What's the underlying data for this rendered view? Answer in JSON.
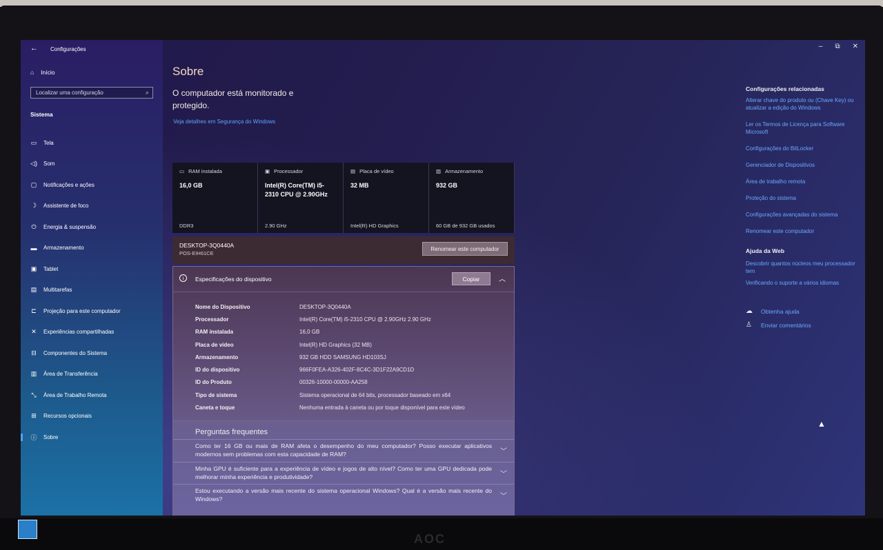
{
  "window": {
    "title": "Configurações",
    "controls": {
      "minimize": "–",
      "maximize": "⧉",
      "close": "✕"
    }
  },
  "sidebar": {
    "home": "Início",
    "search_placeholder": "Localizar uma configuração",
    "section": "Sistema",
    "items": [
      {
        "label": "Tela",
        "icon": "display-icon"
      },
      {
        "label": "Som",
        "icon": "speaker-icon"
      },
      {
        "label": "Notificações e ações",
        "icon": "notification-icon"
      },
      {
        "label": "Assistente de foco",
        "icon": "moon-icon"
      },
      {
        "label": "Energia & suspensão",
        "icon": "power-icon"
      },
      {
        "label": "Armazenamento",
        "icon": "storage-icon"
      },
      {
        "label": "Tablet",
        "icon": "tablet-icon"
      },
      {
        "label": "Multitarefas",
        "icon": "multitask-icon"
      },
      {
        "label": "Projeção para este computador",
        "icon": "projection-icon"
      },
      {
        "label": "Experiências compartilhadas",
        "icon": "shared-icon"
      },
      {
        "label": "Componentes do Sistema",
        "icon": "components-icon"
      },
      {
        "label": "Área de Transferência",
        "icon": "clipboard-icon"
      },
      {
        "label": "Área de Trabalho Remota",
        "icon": "remote-desktop-icon"
      },
      {
        "label": "Recursos opcionais",
        "icon": "optional-features-icon"
      },
      {
        "label": "Sobre",
        "icon": "info-icon"
      }
    ]
  },
  "main": {
    "title": "Sobre",
    "monitor_message": "O computador está monitorado e protegido.",
    "security_link": "Veja detalhes em Segurança do Windows",
    "cards": [
      {
        "head": "RAM instalada",
        "value": "16,0 GB",
        "sub": "DDR3"
      },
      {
        "head": "Processador",
        "value": "Intel(R) Core(TM) i5-2310 CPU @ 2.90GHz",
        "sub": "2.90 GHz"
      },
      {
        "head": "Placa de vídeo",
        "value": "32 MB",
        "sub": "Intel(R) HD Graphics"
      },
      {
        "head": "Armazenamento",
        "value": "932 GB",
        "sub": "60 GB de 932 GB usados"
      }
    ],
    "pc": {
      "name": "DESKTOP-3Q0440A",
      "model": "POS-EIH61CE",
      "rename_button": "Renomear este computador"
    },
    "specs": {
      "title": "Especificações do dispositivo",
      "copy_button": "Copiar",
      "rows": [
        {
          "key": "Nome do Dispositivo",
          "value": "DESKTOP-3Q0440A"
        },
        {
          "key": "Processador",
          "value": "Intel(R) Core(TM) i5-2310 CPU @ 2.90GHz   2.90 GHz"
        },
        {
          "key": "RAM instalada",
          "value": "16,0 GB"
        },
        {
          "key": "Placa de vídeo",
          "value": "Intel(R) HD Graphics (32 MB)"
        },
        {
          "key": "Armazenamento",
          "value": "932 GB HDD SAMSUNG HD103SJ"
        },
        {
          "key": "ID do dispositivo",
          "value": "966F0FEA-A326-402F-8C4C-3D1F22A9CD1D"
        },
        {
          "key": "ID do Produto",
          "value": "00326-10000-00000-AA258"
        },
        {
          "key": "Tipo de sistema",
          "value": "Sistema operacional de 64 bits, processador baseado em x64"
        },
        {
          "key": "Caneta e toque",
          "value": "Nenhuma entrada à caneta ou por toque disponível para este vídeo"
        }
      ]
    },
    "faq": {
      "title": "Perguntas frequentes",
      "items": [
        "Como ter 16 GB ou mais de RAM afeta o desempenho do meu computador? Posso executar aplicativos modernos sem problemas com esta capacidade de RAM?",
        "Minha GPU é suficiente para a experiência de vídeo e jogos de alto nível? Como ter uma GPU dedicada pode melhorar minha experiência e produtividade?",
        "Estou executando a versão mais recente do sistema operacional Windows? Qual é a versão mais recente do Windows?"
      ]
    }
  },
  "related": {
    "title": "Configurações relacionadas",
    "links": [
      "Alterar chave do produto ou (Chave Key) ou atualizar a edição do Windows",
      "Ler os Termos de Licença para Software Microsoft",
      "Configurações do BitLocker",
      "Gerenciador de Dispositivos",
      "Área de trabalho remota",
      "Proteção do sistema",
      "Configurações avançadas do sistema",
      "Renomear este computador"
    ],
    "web_title": "Ajuda da Web",
    "web_links": [
      "Descobrir quantos núcleos meu processador tem",
      "Verificando o suporte a vários idiomas"
    ],
    "help": "Obtenha ajuda",
    "feedback": "Enviar comentários"
  },
  "hardware": {
    "brand": "AOC",
    "badge": "energy"
  }
}
